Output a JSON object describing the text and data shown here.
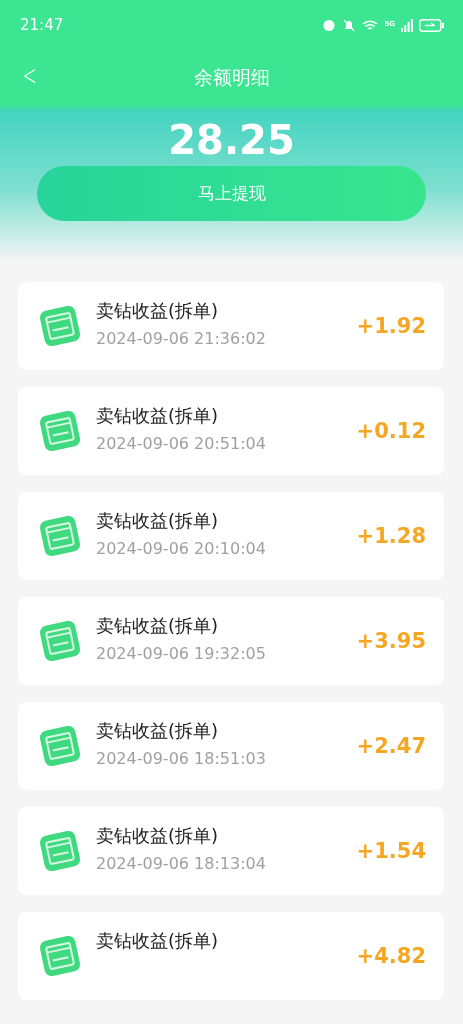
{
  "status_bar": {
    "time": "21:47",
    "network": "5G"
  },
  "header": {
    "title": "余额明细",
    "back": "<"
  },
  "balance": "28.25",
  "withdraw_button": "马上提现",
  "records": [
    {
      "title": "卖钻收益(拆单)",
      "time": "2024-09-06 21:36:02",
      "amount": "+1.92"
    },
    {
      "title": "卖钻收益(拆单)",
      "time": "2024-09-06 20:51:04",
      "amount": "+0.12"
    },
    {
      "title": "卖钻收益(拆单)",
      "time": "2024-09-06 20:10:04",
      "amount": "+1.28"
    },
    {
      "title": "卖钻收益(拆单)",
      "time": "2024-09-06 19:32:05",
      "amount": "+3.95"
    },
    {
      "title": "卖钻收益(拆单)",
      "time": "2024-09-06 18:51:03",
      "amount": "+2.47"
    },
    {
      "title": "卖钻收益(拆单)",
      "time": "2024-09-06 18:13:04",
      "amount": "+1.54"
    },
    {
      "title": "卖钻收益(拆单)",
      "amount": "+4.82"
    }
  ]
}
